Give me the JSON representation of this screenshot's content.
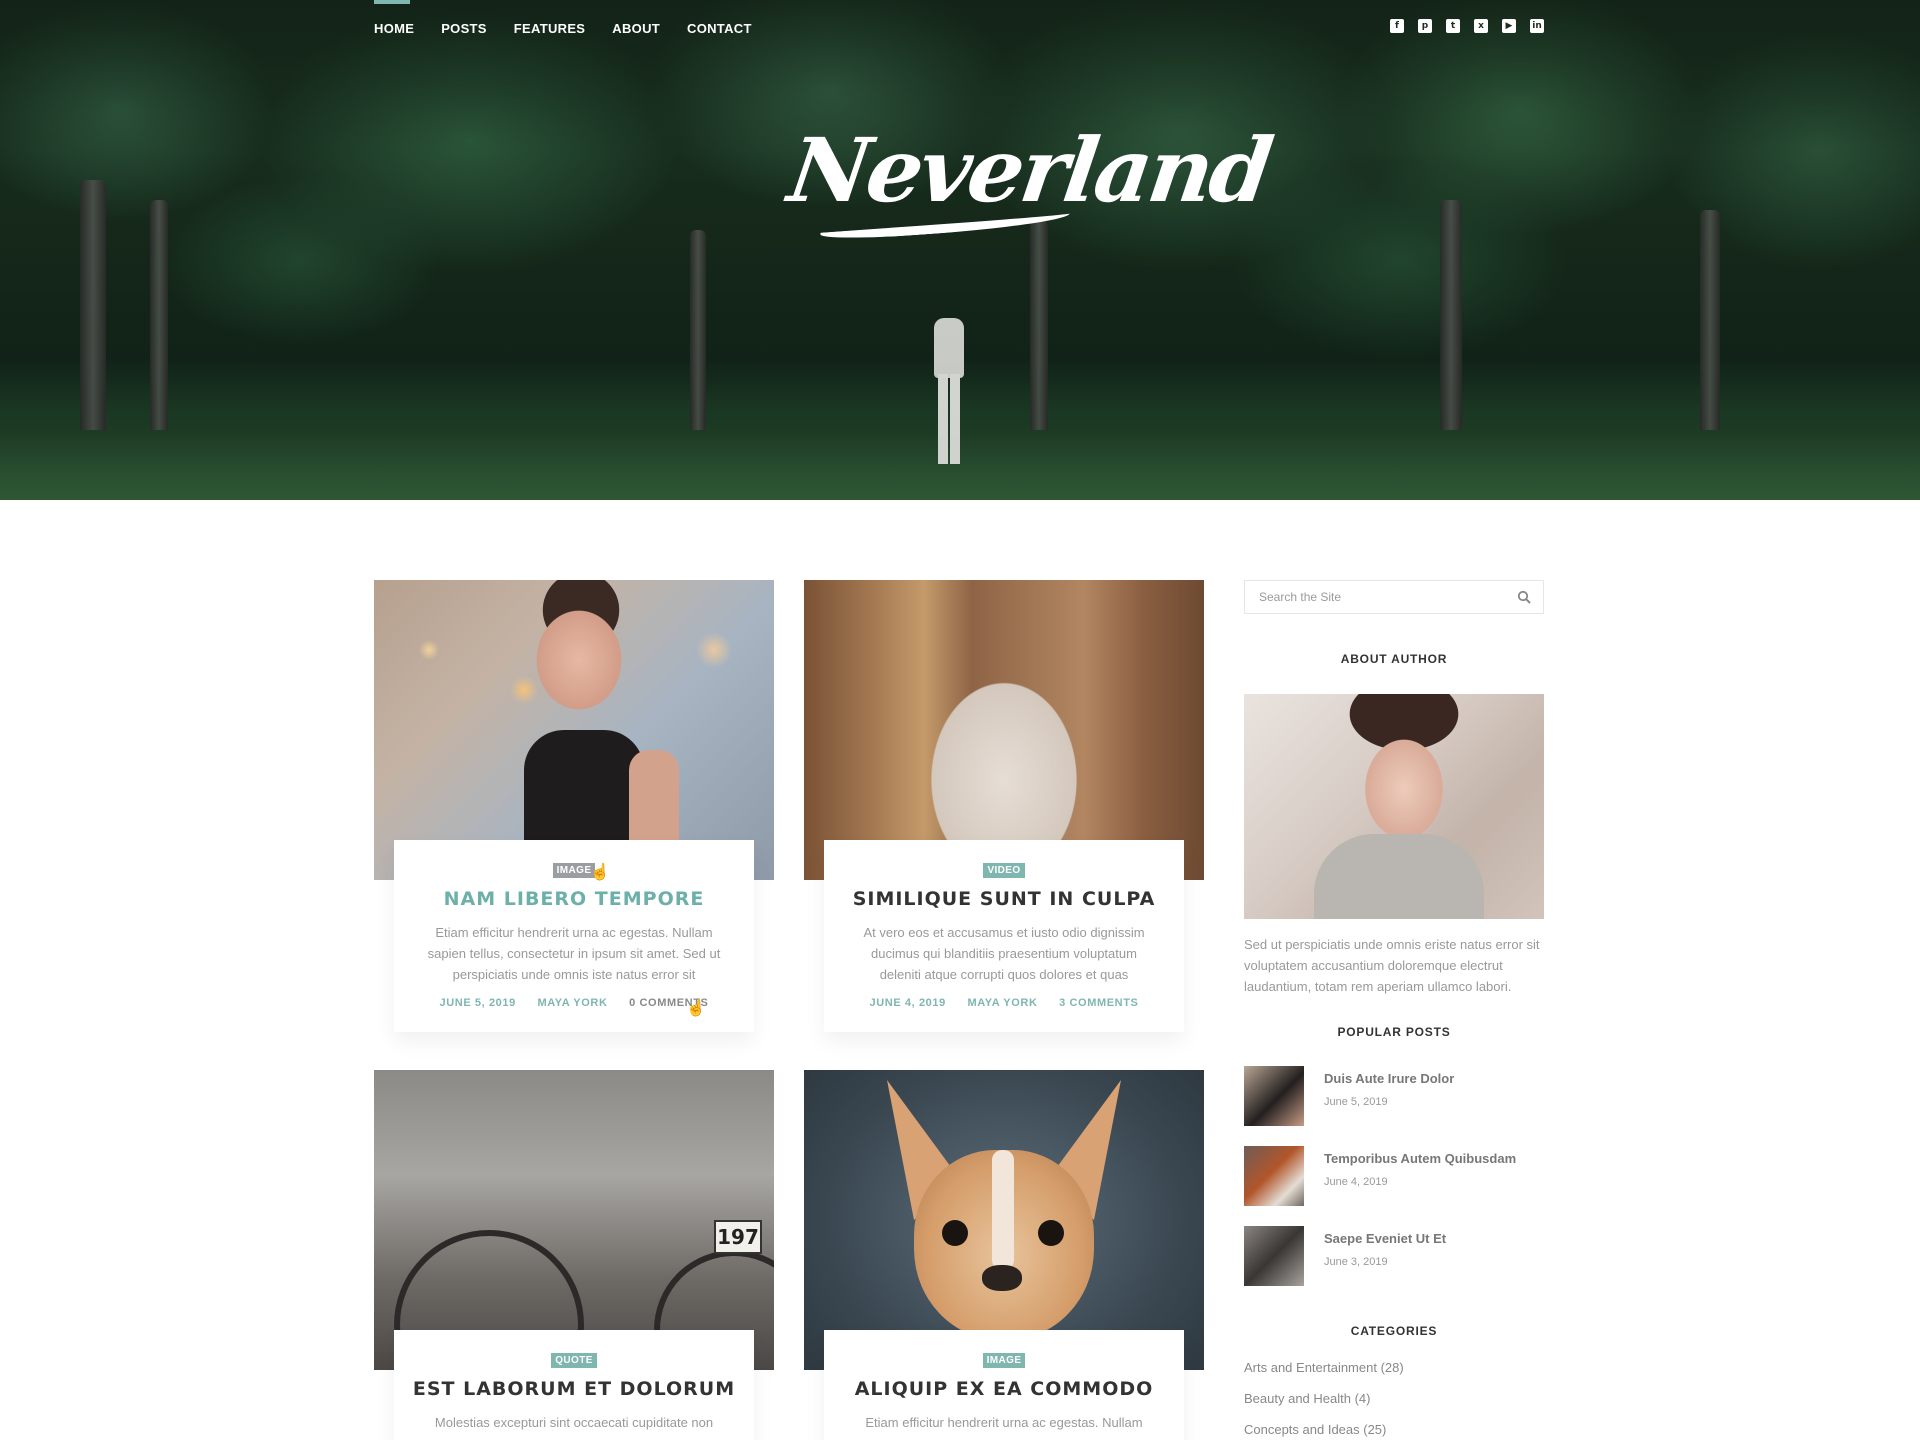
{
  "nav": {
    "items": [
      {
        "label": "HOME",
        "active": true
      },
      {
        "label": "POSTS",
        "active": false
      },
      {
        "label": "FEATURES",
        "active": false
      },
      {
        "label": "ABOUT",
        "active": false
      },
      {
        "label": "CONTACT",
        "active": false
      }
    ]
  },
  "social": [
    {
      "icon": "facebook-icon",
      "glyph": "f"
    },
    {
      "icon": "pinterest-icon",
      "glyph": "p"
    },
    {
      "icon": "twitter-icon",
      "glyph": "t"
    },
    {
      "icon": "xing-icon",
      "glyph": "x"
    },
    {
      "icon": "youtube-icon",
      "glyph": "▶"
    },
    {
      "icon": "linkedin-icon",
      "glyph": "in"
    }
  ],
  "logo": {
    "text": "Neverland"
  },
  "posts": [
    {
      "badge": "IMAGE",
      "title": "NAM LIBERO TEMPORE",
      "excerpt": "Etiam efficitur hendrerit urna ac egestas. Nullam sapien tellus, consectetur in ipsum sit amet. Sed ut perspiciatis unde omnis iste natus error sit",
      "date": "JUNE 5, 2019",
      "author": "MAYA YORK",
      "comments": "0 COMMENTS"
    },
    {
      "badge": "VIDEO",
      "title": "SIMILIQUE SUNT IN CULPA",
      "excerpt": "At vero eos et accusamus et iusto odio dignissim ducimus qui blanditiis praesentium voluptatum deleniti atque corrupti quos dolores et quas",
      "date": "JUNE 4, 2019",
      "author": "MAYA YORK",
      "comments": "3 COMMENTS"
    },
    {
      "badge": "QUOTE",
      "title": "EST LABORUM ET DOLORUM",
      "excerpt": "Molestias excepturi sint occaecati cupiditate non"
    },
    {
      "badge": "IMAGE",
      "title": "ALIQUIP EX EA COMMODO",
      "excerpt": "Etiam efficitur hendrerit urna ac egestas. Nullam"
    }
  ],
  "sidebar": {
    "search_placeholder": "Search the Site",
    "about_title": "ABOUT AUTHOR",
    "about_text": "Sed ut perspiciatis unde omnis eriste natus error sit voluptatem accusantium doloremque electrut laudantium, totam rem aperiam ullamco labori.",
    "popular_title": "POPULAR POSTS",
    "popular": [
      {
        "title": "Duis Aute Irure Dolor",
        "date": "June 5, 2019"
      },
      {
        "title": "Temporibus Autem Quibusdam",
        "date": "June 4, 2019"
      },
      {
        "title": "Saepe Eveniet Ut Et",
        "date": "June 3, 2019"
      }
    ],
    "categories_title": "CATEGORIES",
    "categories": [
      "Arts and Entertainment (28)",
      "Beauty and Health (4)",
      "Concepts and Ideas (25)"
    ]
  },
  "colors": {
    "accent": "#7fb6b0",
    "badge_grey": "#9a9ea1",
    "title_teal": "#6cb0a9"
  }
}
